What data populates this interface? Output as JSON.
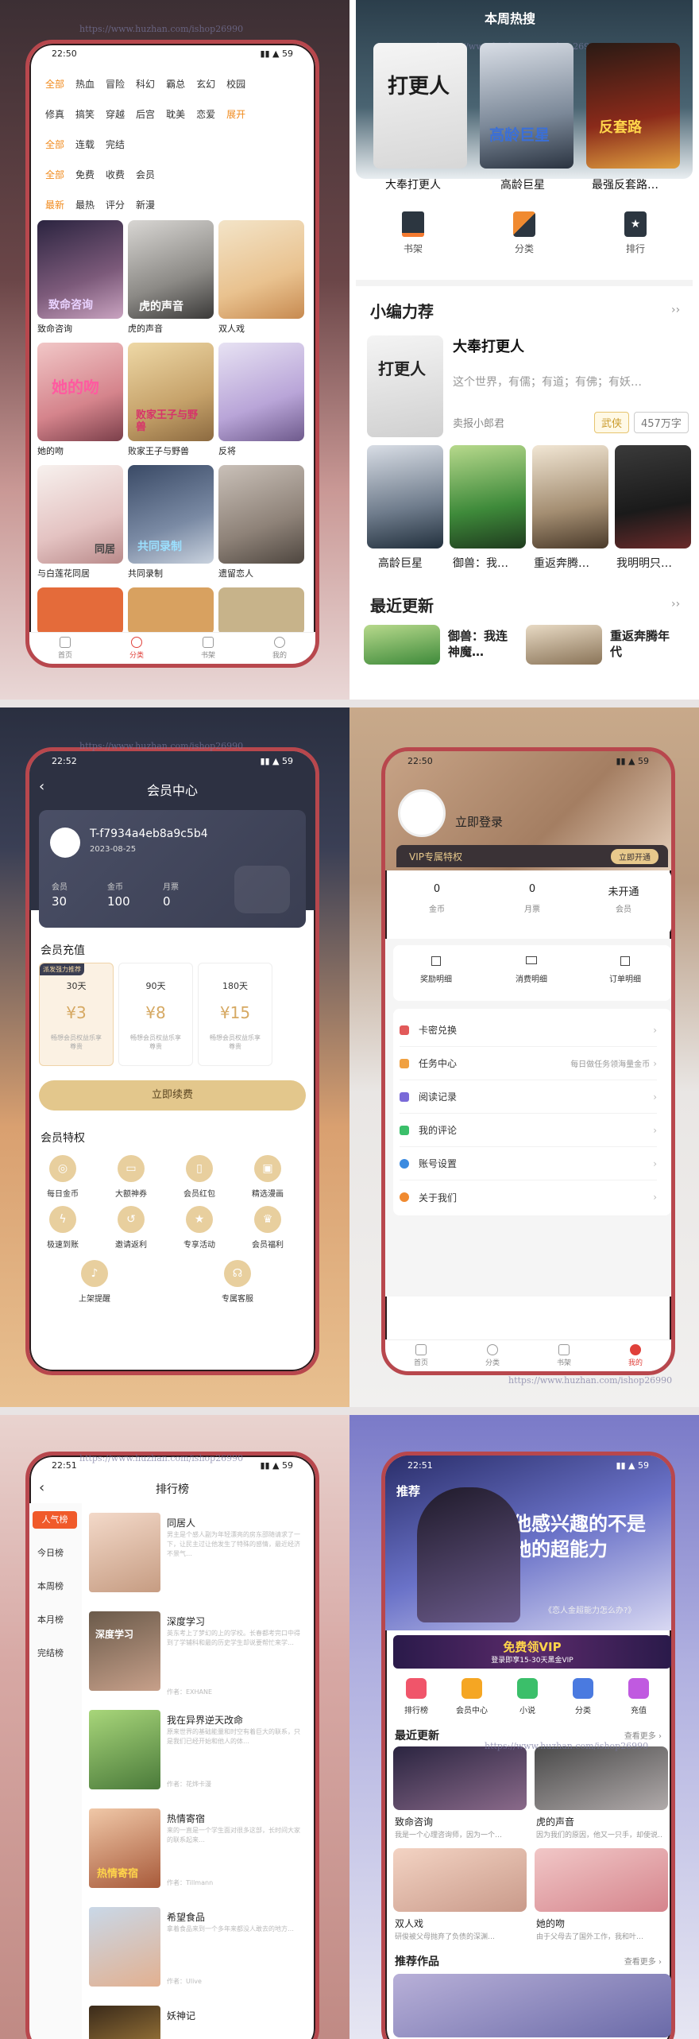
{
  "watermark": "https://www.huzhan.com/ishop26990",
  "p1": {
    "time": "22:50",
    "rows": [
      [
        "全部",
        "热血",
        "冒险",
        "科幻",
        "霸总",
        "玄幻",
        "校园"
      ],
      [
        "修真",
        "搞笑",
        "穿越",
        "后宫",
        "耽美",
        "恋爱",
        "展开"
      ],
      [
        "全部",
        "连载",
        "完结"
      ],
      [
        "全部",
        "免费",
        "收费",
        "会员"
      ],
      [
        "最新",
        "最热",
        "评分",
        "新漫"
      ]
    ],
    "titles": [
      "致命咨询",
      "虎的声音",
      "双人戏",
      "她的吻",
      "败家王子与野兽",
      "反将",
      "与白莲花同居",
      "共同录制",
      "遗留恋人"
    ],
    "cover_text": {
      "a": "致命咨询",
      "b": "虎的声音",
      "d": "她的吻",
      "e": "败家王子与野兽",
      "g": "同居",
      "h": "共同录制"
    },
    "nav": [
      "首页",
      "分类",
      "书架",
      "我的"
    ]
  },
  "p2": {
    "banner": "本周热搜",
    "top": [
      "大奉打更人",
      "高龄巨星",
      "最强反套路…"
    ],
    "top_cover_text": [
      "打更人",
      "高龄巨星",
      "反套路"
    ],
    "icons": [
      "书架",
      "分类",
      "排行"
    ],
    "editor": "小编力荐",
    "editor_title": "大奉打更人",
    "editor_desc": "这个世界，有儒；有道；有佛；有妖…",
    "editor_author": "卖报小郎君",
    "tag1": "武侠",
    "tag2": "457万字",
    "row": [
      "高龄巨星",
      "御兽：我…",
      "重返奔腾…",
      "我明明只…"
    ],
    "recent": "最近更新",
    "recent1": "御兽：我连神魔…",
    "recent2": "重返奔腾年代",
    "more": "››"
  },
  "p3": {
    "time": "22:52",
    "title": "会员中心",
    "uid": "T-f7934a4eb8a9c5b4",
    "date": "2023-08-25",
    "stats": [
      {
        "l": "会员",
        "v": "30"
      },
      {
        "l": "金币",
        "v": "100"
      },
      {
        "l": "月票",
        "v": "0"
      }
    ],
    "recharge": "会员充值",
    "badge": "派发强力推荐",
    "plans": [
      {
        "d": "30天",
        "p": "¥3",
        "n": "畅想会员权益乐享尊贵"
      },
      {
        "d": "90天",
        "p": "¥8",
        "n": "畅想会员权益乐享尊贵"
      },
      {
        "d": "180天",
        "p": "¥15",
        "n": "畅想会员权益乐享尊贵"
      }
    ],
    "btn": "立即续费",
    "priv_title": "会员特权",
    "privs": [
      "每日金币",
      "大额神券",
      "会员红包",
      "精选漫画",
      "极速到账",
      "邀请返利",
      "专享活动",
      "会员福利",
      "上架提醒",
      "专属客服"
    ]
  },
  "p4": {
    "time": "22:50",
    "login": "立即登录",
    "vip": "VIP专属特权",
    "vip_btn": "立即开通",
    "stats": [
      {
        "v": "0",
        "l": "金币"
      },
      {
        "v": "0",
        "l": "月票"
      },
      {
        "v": "未开通",
        "l": "会员"
      }
    ],
    "actions": [
      "奖励明细",
      "消费明细",
      "订单明细"
    ],
    "menu": [
      {
        "l": "卡密兑换",
        "r": ""
      },
      {
        "l": "任务中心",
        "r": "每日做任务领海量金币"
      },
      {
        "l": "阅读记录",
        "r": ""
      },
      {
        "l": "我的评论",
        "r": ""
      },
      {
        "l": "账号设置",
        "r": ""
      },
      {
        "l": "关于我们",
        "r": ""
      }
    ],
    "nav": [
      "首页",
      "分类",
      "书架",
      "我的"
    ]
  },
  "p5": {
    "time": "22:51",
    "title": "排行榜",
    "side": [
      "人气榜",
      "今日榜",
      "本周榜",
      "本月榜",
      "完结榜"
    ],
    "items": [
      {
        "t": "同居人",
        "d": "男主是个感人副为年轻漂亮的房东邵随请求了一下，让民主过让他发生了特殊的感情，最近经济不景气…",
        "a": ""
      },
      {
        "t": "深度学习",
        "d": "英东考上了梦幻的上的学校。长春都考完口中得到了学辅科和最的历史学生却说要帮忙来学…",
        "a": "作者：EXHANE"
      },
      {
        "t": "我在异界逆天改命",
        "d": "原来世界的基础能量和时空有着巨大的联系，只是我们已经开始和他人的体…",
        "a": "作者：花烨卡漫"
      },
      {
        "t": "热情寄宿",
        "d": "来的一直是一个学生面对很多这部，长时间大家的联系起来…",
        "a": "作者：Tillmann"
      },
      {
        "t": "希望食品",
        "d": "拿着食品来到一个多年来都没人敢去的地方…",
        "a": "作者：Ulive"
      },
      {
        "t": "妖神记",
        "d": "",
        "a": ""
      }
    ],
    "covers": [
      "",
      "深度学习",
      "",
      "热情寄宿",
      "",
      ""
    ]
  },
  "p6": {
    "time": "22:51",
    "tab1": "推荐",
    "banner_text": "他感兴趣的不是她的超能力",
    "banner_sub": "《恋人金超能力怎么办?》",
    "vip_banner": "免费领VIP",
    "vip_sub": "登录即享15-30天黑金VIP",
    "icons": [
      "排行榜",
      "会员中心",
      "小说",
      "分类",
      "充值"
    ],
    "recent": "最近更新",
    "more": "查看更多 ›",
    "books": [
      {
        "t": "致命咨询",
        "d": "我是一个心理咨询师，因为一个…"
      },
      {
        "t": "虎的声音",
        "d": "因为我们的原因，他又一只手，却使说…"
      },
      {
        "t": "双人戏",
        "d": "研俊被父母抛弃了负债的深渊…"
      },
      {
        "t": "她的吻",
        "d": "由于父母去了国外工作，我和叶…"
      }
    ],
    "rec": "推荐作品"
  }
}
